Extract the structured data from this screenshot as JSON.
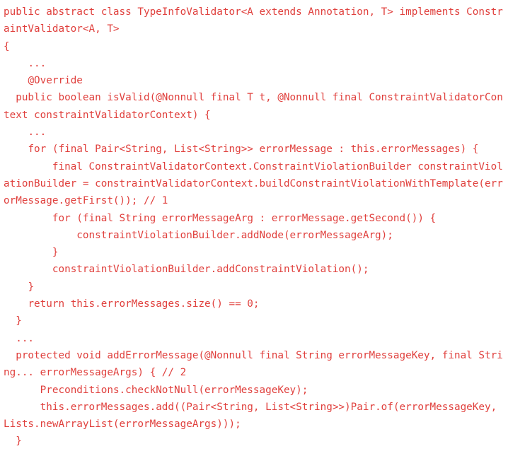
{
  "document": {
    "kind": "code-snippet",
    "language": "java",
    "colors": {
      "background": "#ffffff",
      "text": "#e0403d"
    },
    "wrap_columns": 79,
    "code": "public abstract class TypeInfoValidator<A extends Annotation, T> implements ConstraintValidator<A, T>\n{\n    ...\n    @Override\n  public boolean isValid(@Nonnull final T t, @Nonnull final ConstraintValidatorContext constraintValidatorContext) {\n    ...\n    for (final Pair<String, List<String>> errorMessage : this.errorMessages) {\n        final ConstraintValidatorContext.ConstraintViolationBuilder constraintViolationBuilder = constraintValidatorContext.buildConstraintViolationWithTemplate(errorMessage.getFirst()); // 1\n        for (final String errorMessageArg : errorMessage.getSecond()) {\n            constraintViolationBuilder.addNode(errorMessageArg);\n        }\n        constraintViolationBuilder.addConstraintViolation();\n    }\n    return this.errorMessages.size() == 0;\n  }\n  ...\n  protected void addErrorMessage(@Nonnull final String errorMessageKey, final String... errorMessageArgs) { // 2\n      Preconditions.checkNotNull(errorMessageKey);\n      this.errorMessages.add((Pair<String, List<String>>)Pair.of(errorMessageKey, Lists.newArrayList(errorMessageArgs)));\n  }",
    "lines": [
      "public abstract class TypeInfoValidator<A extends Annotation, T> implements ConstraintValidator<A, T>",
      "{",
      "    ...",
      "    @Override",
      "  public boolean isValid(@Nonnull final T t, @Nonnull final ConstraintValidatorContext constraintValidatorContext) {",
      "    ...",
      "    for (final Pair<String, List<String>> errorMessage : this.errorMessages) {",
      "        final ConstraintValidatorContext.ConstraintViolationBuilder constraintViolationBuilder = constraintValidatorContext.buildConstraintViolationWithTemplate(errorMessage.getFirst()); // 1",
      "        for (final String errorMessageArg : errorMessage.getSecond()) {",
      "            constraintViolationBuilder.addNode(errorMessageArg);",
      "        }",
      "        constraintViolationBuilder.addConstraintViolation();",
      "    }",
      "    return this.errorMessages.size() == 0;",
      "  }",
      "  ...",
      "  protected void addErrorMessage(@Nonnull final String errorMessageKey, final String... errorMessageArgs) { // 2",
      "      Preconditions.checkNotNull(errorMessageKey);",
      "      this.errorMessages.add((Pair<String, List<String>>)Pair.of(errorMessageKey, Lists.newArrayList(errorMessageArgs)));",
      "  }"
    ]
  }
}
